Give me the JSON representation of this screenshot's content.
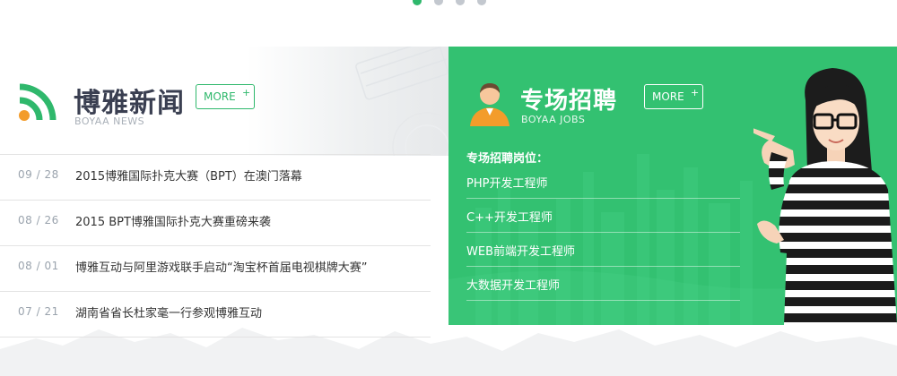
{
  "carousel": {
    "dot_count": 4,
    "active_index": 0,
    "active_color": "#2fb86c"
  },
  "news": {
    "title": "博雅新闻",
    "subtitle": "BOYAA NEWS",
    "more_label": "MORE",
    "more_plus": "+",
    "icon": "rss-icon",
    "items": [
      {
        "date": "09 / 28",
        "text": "2015博雅国际扑克大赛（BPT）在澳门落幕"
      },
      {
        "date": "08 / 26",
        "text": "2015 BPT博雅国际扑克大赛重磅来袭"
      },
      {
        "date": "08 / 01",
        "text": "博雅互动与阿里游戏联手启动“淘宝杯首届电视棋牌大赛”"
      },
      {
        "date": "07 / 21",
        "text": "湖南省省长杜家毫一行参观博雅互动"
      }
    ]
  },
  "jobs": {
    "title": "专场招聘",
    "subtitle": "BOYAA JOBS",
    "more_label": "MORE",
    "more_plus": "+",
    "icon": "person-icon",
    "positions_label": "专场招聘岗位：",
    "positions": [
      "PHP开发工程师",
      "C++开发工程师",
      "WEB前端开发工程师",
      "大数据开发工程师"
    ],
    "accent_color": "#33c171"
  }
}
